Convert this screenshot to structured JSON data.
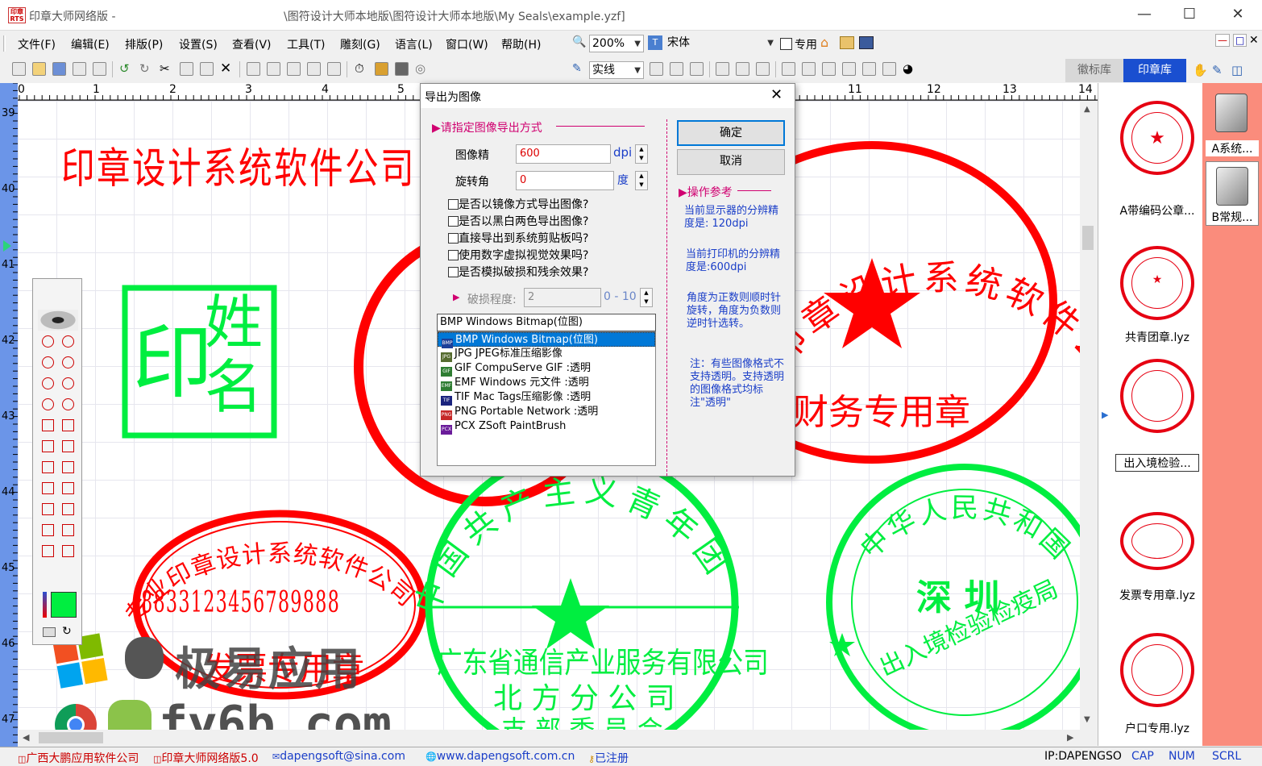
{
  "window": {
    "app_title": "印章大师网络版 -",
    "doc_path": "\\图符设计大师本地版\\图符设计大师本地版\\My Seals\\example.yzf]",
    "app_icon_text": "印章\nRTS"
  },
  "menu": [
    "文件(F)",
    "编辑(E)",
    "排版(P)",
    "设置(S)",
    "查看(V)",
    "工具(T)",
    "雕刻(G)",
    "语言(L)",
    "窗口(W)",
    "帮助(H)"
  ],
  "toolbar": {
    "zoom": "200%",
    "font": "宋体",
    "special_label": "专用",
    "line_style": "实线"
  },
  "ruler": {
    "h": [
      "0",
      "1",
      "2",
      "3",
      "4",
      "5",
      "10",
      "11",
      "12",
      "13",
      "14"
    ],
    "v": [
      "39",
      "40",
      "41",
      "42",
      "43",
      "44",
      "45",
      "46",
      "47"
    ]
  },
  "right_tabs": {
    "emblem": "徽标库",
    "seal": "印章库"
  },
  "seal_library": [
    {
      "name": "A带编码公章...",
      "color": "#e60012"
    },
    {
      "name": "共青团章.lyz",
      "color": "#e60012"
    },
    {
      "name": "出入境检验...",
      "color": "#e60012"
    },
    {
      "name": "发票专用章.lyz",
      "color": "#e60012"
    },
    {
      "name": "户口专用.lyz",
      "color": "#e60012"
    }
  ],
  "folders": [
    "A系统...",
    "B常规..."
  ],
  "canvas": {
    "title_text": "印章设计系统软件公司",
    "square_seal": {
      "left": "印",
      "right1": "姓",
      "right2": "名"
    },
    "oval_seal": {
      "arc": "专业印章设计系统软件公司",
      "number": "8833123456789888",
      "bottom": "发票专用章"
    },
    "round_red": {
      "arc": "印章设计系统软件公司",
      "bottom": "财务专用章"
    },
    "green_round": {
      "arc": "中国共产主义青年团",
      "line1": "广东省通信产业服务有限公司",
      "line2": "北 方 分 公 司",
      "line3": "支 部 委 员 会"
    },
    "green_round2": {
      "arc": "中华人民共和国",
      "center": "深 圳",
      "bottom": "出入境检验检疫局"
    },
    "watermark1": "极易应用",
    "watermark2": "fy6b.com"
  },
  "dialog": {
    "title": "导出为图像",
    "section": "请指定图像导出方式",
    "dpi_label": "图像精",
    "dpi_value": "600",
    "dpi_unit": "dpi",
    "angle_label": "旋转角",
    "angle_value": "0",
    "angle_unit": "度",
    "checks": [
      "是否以镜像方式导出图像?",
      "是否以黑白两色导出图像?",
      "直接导出到系统剪贴板吗?",
      "使用数字虚拟视觉效果吗?",
      "是否模拟破损和残余效果?"
    ],
    "damage_label": "破损程度:",
    "damage_value": "2",
    "damage_range": "0 - 10",
    "format_selected": "BMP Windows Bitmap(位图)",
    "formats": [
      {
        "icon": "BMP",
        "label": "BMP Windows Bitmap(位图)",
        "color": "#1c3f99"
      },
      {
        "icon": "JPG",
        "label": "JPG JPEG标准压缩影像",
        "color": "#556b2f"
      },
      {
        "icon": "GIF",
        "label": "GIF CompuServe GIF :透明",
        "color": "#2e7d32"
      },
      {
        "icon": "EMF",
        "label": "EMF Windows 元文件 :透明",
        "color": "#2e7d32"
      },
      {
        "icon": "TIF",
        "label": "TIF Mac Tags压缩影像 :透明",
        "color": "#1a237e"
      },
      {
        "icon": "PNG",
        "label": "PNG Portable Network :透明",
        "color": "#c62828"
      },
      {
        "icon": "PCX",
        "label": "PCX ZSoft PaintBrush",
        "color": "#6a1b9a"
      }
    ],
    "ok": "确定",
    "cancel": "取消",
    "ref_title": "操作参考",
    "note1": "当前显示器的分辨精度是: 120dpi",
    "note2": "当前打印机的分辨精度是:600dpi",
    "note3": "角度为正数则顺时针旋转，角度为负数则逆时针选转。",
    "note4": "注：有些图像格式不支持透明。支持透明的图像格式均标注\"透明\""
  },
  "status": {
    "company": "广西大鹏应用软件公司",
    "product": "印章大师网络版5.0",
    "email": "dapengsoft@sina.com",
    "web": "www.dapengsoft.com.cn",
    "reg": "已注册",
    "ip": "IP:DAPENGSO",
    "cap": "CAP",
    "num": "NUM",
    "scrl": "SCRL"
  }
}
